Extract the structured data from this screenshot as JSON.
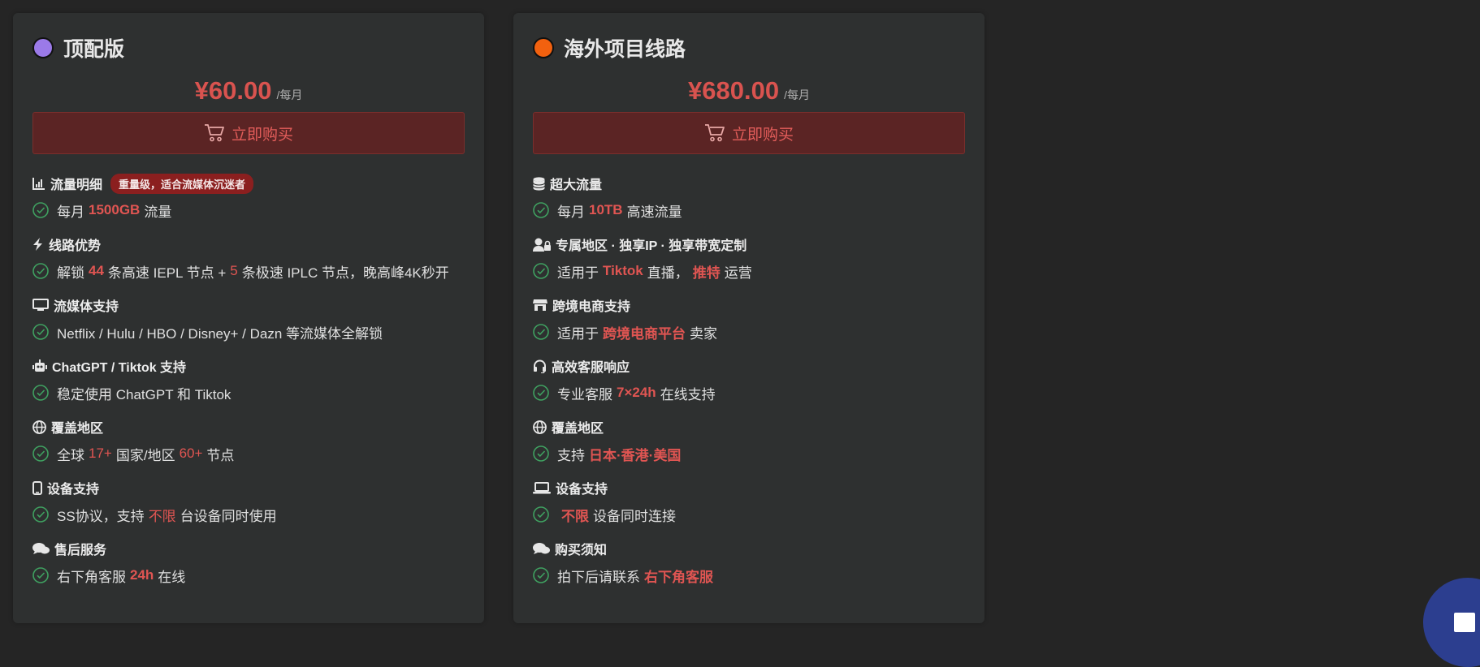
{
  "cards": [
    {
      "title": "顶配版",
      "dot_color": "#9b7ae8",
      "price": "¥60.00",
      "period": "/每月",
      "buy_label": "立即购买",
      "features": [
        {
          "icon": "bar-chart-icon",
          "title": "流量明细",
          "badge": "重量级，适合流媒体沉迷者",
          "segs": [
            {
              "t": "每月"
            },
            {
              "t": "1500GB",
              "h": 1
            },
            {
              "t": "流量"
            }
          ]
        },
        {
          "icon": "bolt-icon",
          "title": "线路优势",
          "segs": [
            {
              "t": "解锁"
            },
            {
              "t": "44",
              "h": 1
            },
            {
              "t": "条高速 IEPL 节点 +"
            },
            {
              "t": "5",
              "h": 2
            },
            {
              "t": "条极速 IPLC 节点，晚高峰4K秒开"
            }
          ]
        },
        {
          "icon": "monitor-icon",
          "title": "流媒体支持",
          "segs": [
            {
              "t": "Netflix / Hulu / HBO / Disney+ / Dazn 等流媒体全解锁"
            }
          ]
        },
        {
          "icon": "robot-icon",
          "title": "ChatGPT / Tiktok 支持",
          "segs": [
            {
              "t": "稳定使用 ChatGPT 和 Tiktok"
            }
          ]
        },
        {
          "icon": "globe-icon",
          "title": "覆盖地区",
          "segs": [
            {
              "t": "全球"
            },
            {
              "t": "17+",
              "h": 2
            },
            {
              "t": "国家/地区"
            },
            {
              "t": "60+",
              "h": 2
            },
            {
              "t": "节点"
            }
          ]
        },
        {
          "icon": "mobile-icon",
          "title": "设备支持",
          "segs": [
            {
              "t": "SS协议，支持"
            },
            {
              "t": "不限",
              "h": 2
            },
            {
              "t": "台设备同时使用"
            }
          ]
        },
        {
          "icon": "chat-icon",
          "title": "售后服务",
          "segs": [
            {
              "t": "右下角客服"
            },
            {
              "t": "24h",
              "h": 1
            },
            {
              "t": "在线"
            }
          ]
        }
      ]
    },
    {
      "title": "海外项目线路",
      "dot_color": "#f2610f",
      "price": "¥680.00",
      "period": "/每月",
      "buy_label": "立即购买",
      "features": [
        {
          "icon": "database-icon",
          "title": "超大流量",
          "segs": [
            {
              "t": "每月"
            },
            {
              "t": "10TB",
              "h": 1
            },
            {
              "t": "高速流量"
            }
          ]
        },
        {
          "icon": "user-lock-icon",
          "title": "专属地区 · 独享IP · 独享带宽定制",
          "segs": [
            {
              "t": "适用于"
            },
            {
              "t": "Tiktok",
              "h": 1
            },
            {
              "t": "直播，"
            },
            {
              "t": "推特",
              "h": 1
            },
            {
              "t": "运营"
            }
          ]
        },
        {
          "icon": "store-icon",
          "title": "跨境电商支持",
          "segs": [
            {
              "t": "适用于"
            },
            {
              "t": "跨境电商平台",
              "h": 1
            },
            {
              "t": "卖家"
            }
          ]
        },
        {
          "icon": "headset-icon",
          "title": "高效客服响应",
          "segs": [
            {
              "t": "专业客服"
            },
            {
              "t": "7×24h",
              "h": 1
            },
            {
              "t": "在线支持"
            }
          ]
        },
        {
          "icon": "globe-icon",
          "title": "覆盖地区",
          "segs": [
            {
              "t": "支持"
            },
            {
              "t": "日本·香港·美国",
              "h": 1
            }
          ]
        },
        {
          "icon": "laptop-icon",
          "title": "设备支持",
          "segs": [
            {
              "t": "不限",
              "h": 1
            },
            {
              "t": "设备同时连接"
            }
          ]
        },
        {
          "icon": "chat-icon",
          "title": "购买须知",
          "segs": [
            {
              "t": "拍下后请联系"
            },
            {
              "t": "右下角客服",
              "h": 1
            }
          ]
        }
      ]
    }
  ]
}
